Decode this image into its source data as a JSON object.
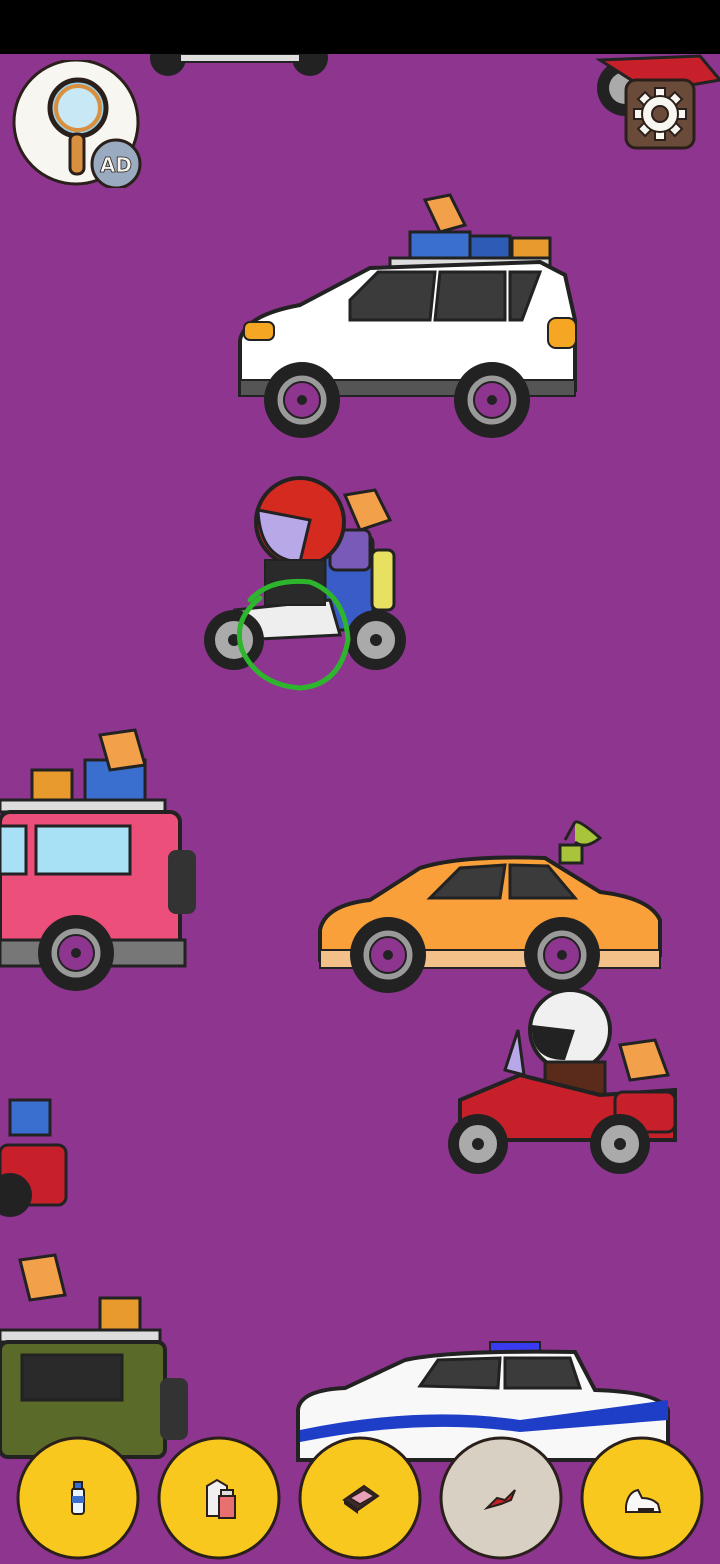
{
  "game": {
    "hint_button": {
      "badge": "AD",
      "icon": "magnifier-icon"
    },
    "settings_button": {
      "icon": "gear-icon"
    },
    "found_marker": {
      "target": "dummy-on-scooter",
      "color": "#2db52d"
    },
    "item_tray": [
      {
        "item": "water-bottle-icon",
        "state": "pending"
      },
      {
        "item": "milk-carton-icon",
        "state": "pending"
      },
      {
        "item": "wallet-icon",
        "state": "pending"
      },
      {
        "item": "candy-icon",
        "state": "found"
      },
      {
        "item": "sneaker-icon",
        "state": "pending"
      }
    ]
  },
  "colors": {
    "background": "#8e3590",
    "tray_slot": "#f8c81e",
    "tray_slot_found": "#d9d0c4",
    "outline": "#2a1f1a"
  }
}
